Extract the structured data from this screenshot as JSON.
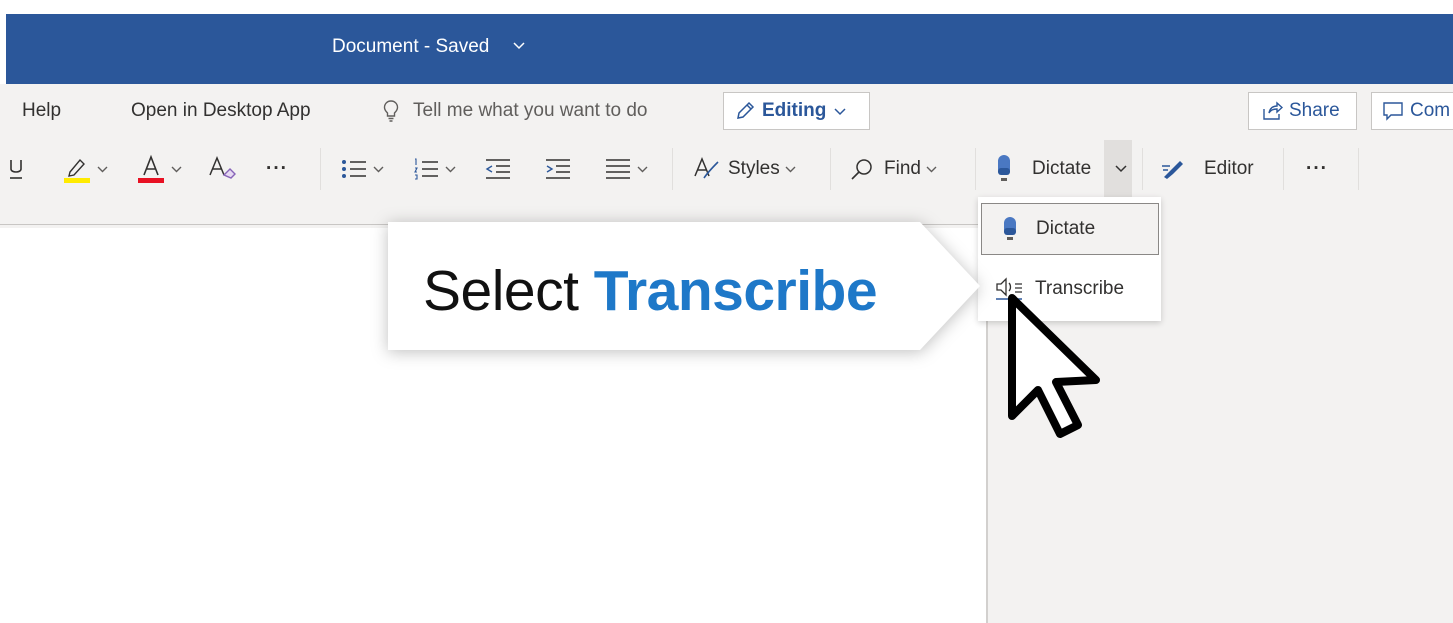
{
  "title_bar": {
    "document_title": "Document - Saved",
    "title_chevron": "chevron-down-icon",
    "background_color": "#2b579a"
  },
  "menu": {
    "help": "Help",
    "open_desktop": "Open in Desktop App",
    "tell_me_placeholder": "Tell me what you want to do",
    "editing": "Editing",
    "share": "Share",
    "comments": "Com"
  },
  "ribbon": {
    "styles": "Styles",
    "find": "Find",
    "dictate": "Dictate",
    "editor": "Editor",
    "more": "···",
    "overflow": "···"
  },
  "dropdown": {
    "items": [
      {
        "label": "Dictate",
        "icon": "microphone-icon",
        "selected": true
      },
      {
        "label": "Transcribe",
        "icon": "transcribe-icon",
        "selected": false
      }
    ]
  },
  "callout": {
    "prefix": "Select ",
    "highlight": "Transcribe",
    "highlight_color": "#1e78c8"
  },
  "colors": {
    "accent": "#2b579a",
    "highlighter": "#ffeb00",
    "font_color": "#e81123"
  }
}
